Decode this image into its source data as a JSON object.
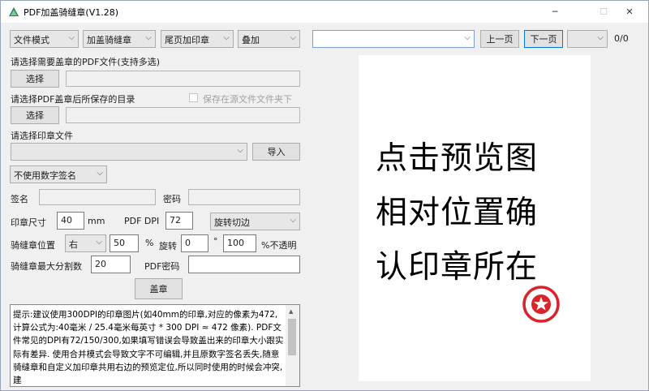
{
  "window": {
    "title": "PDF加盖骑缝章(V1.28)",
    "minimize": "─",
    "maximize": "☐",
    "close": "✕"
  },
  "toolbar": {
    "mode": "文件模式",
    "stamp_type": "加盖骑缝章",
    "last_page": "尾页加印章",
    "overlay": "叠加",
    "file_select": "",
    "prev_page": "上一页",
    "next_page": "下一页",
    "page_select": "",
    "page_count": "0/0"
  },
  "pdf_files": {
    "label": "请选择需要盖章的PDF文件(支持多选)",
    "button": "选择",
    "value": ""
  },
  "output_dir": {
    "label": "请选择PDF盖章后所保存的目录",
    "button": "选择",
    "value": "",
    "checkbox_label": "保存在源文件文件夹下"
  },
  "stamp_file": {
    "label": "请选择印章文件",
    "value": "",
    "import_button": "导入"
  },
  "signature": {
    "mode": "不使用数字签名",
    "sign_label": "签名",
    "sign_value": "",
    "password_label": "密码",
    "password_value": ""
  },
  "stamp_size": {
    "label": "印章尺寸",
    "value": "40",
    "unit": "mm",
    "dpi_label": "PDF DPI",
    "dpi_value": "72",
    "rotate_mode": "旋转切边"
  },
  "seam_position": {
    "label": "骑缝章位置",
    "side": "右",
    "value": "50",
    "percent": "%",
    "rotate_label": "旋转",
    "rotate_value": "0",
    "degree": "°",
    "opacity_value": "100",
    "opacity_label": "%不透明"
  },
  "split": {
    "label": "骑缝章最大分割数",
    "value": "20",
    "pdf_password_label": "PDF密码",
    "pdf_password_value": ""
  },
  "stamp_button": "盖章",
  "notes": "提示:建议使用300DPI的印章图片(如40mm的印章,对应的像素为472,计算公式为:40毫米 / 25.4毫米每英寸 * 300 DPI ≈ 472 像素). PDF文件常见的DPI有72/150/300,如果填写错误会导致盖出来的印章大小跟实际有差异. 使用合并模式会导致文字不可编辑,并且原数字签名丢失,随意骑缝章和自定义加印章共用右边的预览定位,所以同时使用的时候会冲突,建",
  "preview": {
    "line1": "点击预览图",
    "line2": "相对位置确",
    "line3": "认印章所在"
  },
  "colors": {
    "stamp_red": "#d8242a",
    "focus_blue": "#0078d7"
  }
}
